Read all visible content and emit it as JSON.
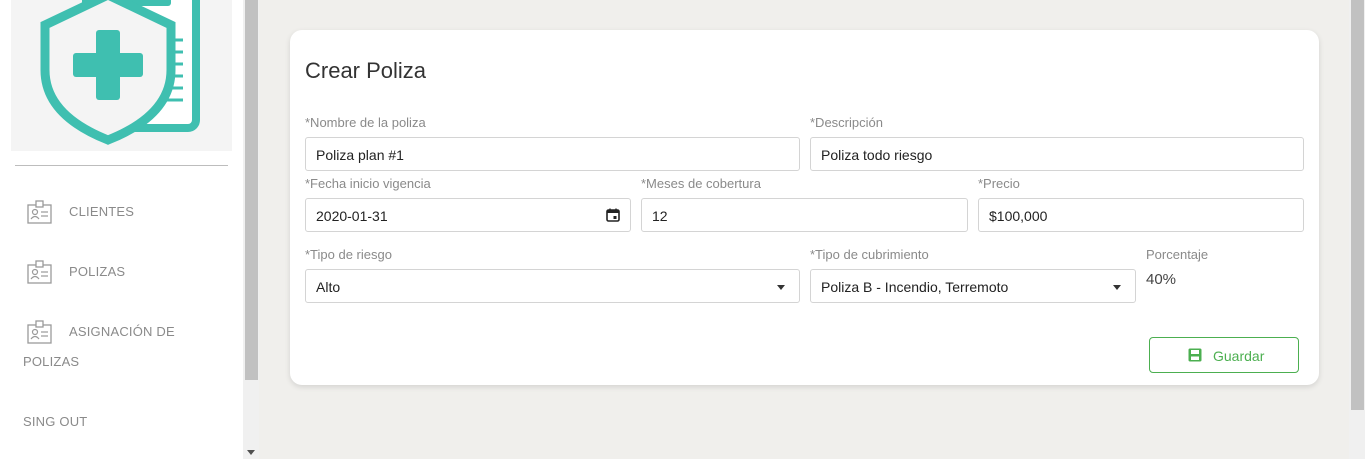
{
  "sidebar": {
    "items": [
      {
        "label": "CLIENTES",
        "icon": "id-card-icon"
      },
      {
        "label": "POLIZAS",
        "icon": "id-card-icon"
      },
      {
        "label": "ASIGNACIÓN DE",
        "label2": "POLIZAS",
        "icon": "id-card-icon"
      },
      {
        "label": "SING OUT"
      }
    ],
    "logo": "insurance-shield-cross-icon"
  },
  "form": {
    "title": "Crear Poliza",
    "nombre": {
      "label": "*Nombre de la poliza",
      "value": "Poliza plan #1"
    },
    "descripcion": {
      "label": "*Descripción",
      "value": "Poliza todo riesgo"
    },
    "fecha": {
      "label": "*Fecha inicio vigencia",
      "value": "2020-01-31"
    },
    "meses": {
      "label": "*Meses de cobertura",
      "value": "12"
    },
    "precio": {
      "label": "*Precio",
      "value": "$100,000"
    },
    "riesgo": {
      "label": "*Tipo de riesgo",
      "value": "Alto"
    },
    "cubrimiento": {
      "label": "*Tipo de cubrimiento",
      "value": "Poliza B - Incendio, Terremoto"
    },
    "porcentaje": {
      "label": "Porcentaje",
      "value": "40%"
    },
    "save_label": "Guardar"
  },
  "colors": {
    "accent": "#4caf50",
    "logo_teal": "#3fbfb0",
    "page_bg": "#f0efec"
  }
}
